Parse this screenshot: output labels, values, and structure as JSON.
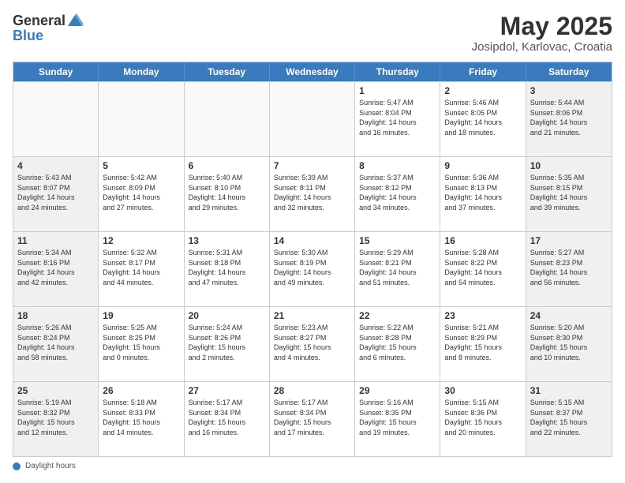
{
  "header": {
    "logo_general": "General",
    "logo_blue": "Blue",
    "month_title": "May 2025",
    "location": "Josipdol, Karlovac, Croatia"
  },
  "days_of_week": [
    "Sunday",
    "Monday",
    "Tuesday",
    "Wednesday",
    "Thursday",
    "Friday",
    "Saturday"
  ],
  "weeks": [
    [
      {
        "day": "",
        "empty": true
      },
      {
        "day": "",
        "empty": true
      },
      {
        "day": "",
        "empty": true
      },
      {
        "day": "",
        "empty": true
      },
      {
        "day": "1",
        "shaded": false,
        "lines": [
          "Sunrise: 5:47 AM",
          "Sunset: 8:04 PM",
          "Daylight: 14 hours",
          "and 16 minutes."
        ]
      },
      {
        "day": "2",
        "shaded": false,
        "lines": [
          "Sunrise: 5:46 AM",
          "Sunset: 8:05 PM",
          "Daylight: 14 hours",
          "and 18 minutes."
        ]
      },
      {
        "day": "3",
        "shaded": true,
        "lines": [
          "Sunrise: 5:44 AM",
          "Sunset: 8:06 PM",
          "Daylight: 14 hours",
          "and 21 minutes."
        ]
      }
    ],
    [
      {
        "day": "4",
        "shaded": true,
        "lines": [
          "Sunrise: 5:43 AM",
          "Sunset: 8:07 PM",
          "Daylight: 14 hours",
          "and 24 minutes."
        ]
      },
      {
        "day": "5",
        "shaded": false,
        "lines": [
          "Sunrise: 5:42 AM",
          "Sunset: 8:09 PM",
          "Daylight: 14 hours",
          "and 27 minutes."
        ]
      },
      {
        "day": "6",
        "shaded": false,
        "lines": [
          "Sunrise: 5:40 AM",
          "Sunset: 8:10 PM",
          "Daylight: 14 hours",
          "and 29 minutes."
        ]
      },
      {
        "day": "7",
        "shaded": false,
        "lines": [
          "Sunrise: 5:39 AM",
          "Sunset: 8:11 PM",
          "Daylight: 14 hours",
          "and 32 minutes."
        ]
      },
      {
        "day": "8",
        "shaded": false,
        "lines": [
          "Sunrise: 5:37 AM",
          "Sunset: 8:12 PM",
          "Daylight: 14 hours",
          "and 34 minutes."
        ]
      },
      {
        "day": "9",
        "shaded": false,
        "lines": [
          "Sunrise: 5:36 AM",
          "Sunset: 8:13 PM",
          "Daylight: 14 hours",
          "and 37 minutes."
        ]
      },
      {
        "day": "10",
        "shaded": true,
        "lines": [
          "Sunrise: 5:35 AM",
          "Sunset: 8:15 PM",
          "Daylight: 14 hours",
          "and 39 minutes."
        ]
      }
    ],
    [
      {
        "day": "11",
        "shaded": true,
        "lines": [
          "Sunrise: 5:34 AM",
          "Sunset: 8:16 PM",
          "Daylight: 14 hours",
          "and 42 minutes."
        ]
      },
      {
        "day": "12",
        "shaded": false,
        "lines": [
          "Sunrise: 5:32 AM",
          "Sunset: 8:17 PM",
          "Daylight: 14 hours",
          "and 44 minutes."
        ]
      },
      {
        "day": "13",
        "shaded": false,
        "lines": [
          "Sunrise: 5:31 AM",
          "Sunset: 8:18 PM",
          "Daylight: 14 hours",
          "and 47 minutes."
        ]
      },
      {
        "day": "14",
        "shaded": false,
        "lines": [
          "Sunrise: 5:30 AM",
          "Sunset: 8:19 PM",
          "Daylight: 14 hours",
          "and 49 minutes."
        ]
      },
      {
        "day": "15",
        "shaded": false,
        "lines": [
          "Sunrise: 5:29 AM",
          "Sunset: 8:21 PM",
          "Daylight: 14 hours",
          "and 51 minutes."
        ]
      },
      {
        "day": "16",
        "shaded": false,
        "lines": [
          "Sunrise: 5:28 AM",
          "Sunset: 8:22 PM",
          "Daylight: 14 hours",
          "and 54 minutes."
        ]
      },
      {
        "day": "17",
        "shaded": true,
        "lines": [
          "Sunrise: 5:27 AM",
          "Sunset: 8:23 PM",
          "Daylight: 14 hours",
          "and 56 minutes."
        ]
      }
    ],
    [
      {
        "day": "18",
        "shaded": true,
        "lines": [
          "Sunrise: 5:26 AM",
          "Sunset: 8:24 PM",
          "Daylight: 14 hours",
          "and 58 minutes."
        ]
      },
      {
        "day": "19",
        "shaded": false,
        "lines": [
          "Sunrise: 5:25 AM",
          "Sunset: 8:25 PM",
          "Daylight: 15 hours",
          "and 0 minutes."
        ]
      },
      {
        "day": "20",
        "shaded": false,
        "lines": [
          "Sunrise: 5:24 AM",
          "Sunset: 8:26 PM",
          "Daylight: 15 hours",
          "and 2 minutes."
        ]
      },
      {
        "day": "21",
        "shaded": false,
        "lines": [
          "Sunrise: 5:23 AM",
          "Sunset: 8:27 PM",
          "Daylight: 15 hours",
          "and 4 minutes."
        ]
      },
      {
        "day": "22",
        "shaded": false,
        "lines": [
          "Sunrise: 5:22 AM",
          "Sunset: 8:28 PM",
          "Daylight: 15 hours",
          "and 6 minutes."
        ]
      },
      {
        "day": "23",
        "shaded": false,
        "lines": [
          "Sunrise: 5:21 AM",
          "Sunset: 8:29 PM",
          "Daylight: 15 hours",
          "and 8 minutes."
        ]
      },
      {
        "day": "24",
        "shaded": true,
        "lines": [
          "Sunrise: 5:20 AM",
          "Sunset: 8:30 PM",
          "Daylight: 15 hours",
          "and 10 minutes."
        ]
      }
    ],
    [
      {
        "day": "25",
        "shaded": true,
        "lines": [
          "Sunrise: 5:19 AM",
          "Sunset: 8:32 PM",
          "Daylight: 15 hours",
          "and 12 minutes."
        ]
      },
      {
        "day": "26",
        "shaded": false,
        "lines": [
          "Sunrise: 5:18 AM",
          "Sunset: 8:33 PM",
          "Daylight: 15 hours",
          "and 14 minutes."
        ]
      },
      {
        "day": "27",
        "shaded": false,
        "lines": [
          "Sunrise: 5:17 AM",
          "Sunset: 8:34 PM",
          "Daylight: 15 hours",
          "and 16 minutes."
        ]
      },
      {
        "day": "28",
        "shaded": false,
        "lines": [
          "Sunrise: 5:17 AM",
          "Sunset: 8:34 PM",
          "Daylight: 15 hours",
          "and 17 minutes."
        ]
      },
      {
        "day": "29",
        "shaded": false,
        "lines": [
          "Sunrise: 5:16 AM",
          "Sunset: 8:35 PM",
          "Daylight: 15 hours",
          "and 19 minutes."
        ]
      },
      {
        "day": "30",
        "shaded": false,
        "lines": [
          "Sunrise: 5:15 AM",
          "Sunset: 8:36 PM",
          "Daylight: 15 hours",
          "and 20 minutes."
        ]
      },
      {
        "day": "31",
        "shaded": true,
        "lines": [
          "Sunrise: 5:15 AM",
          "Sunset: 8:37 PM",
          "Daylight: 15 hours",
          "and 22 minutes."
        ]
      }
    ]
  ],
  "footer": {
    "label": "Daylight hours"
  }
}
